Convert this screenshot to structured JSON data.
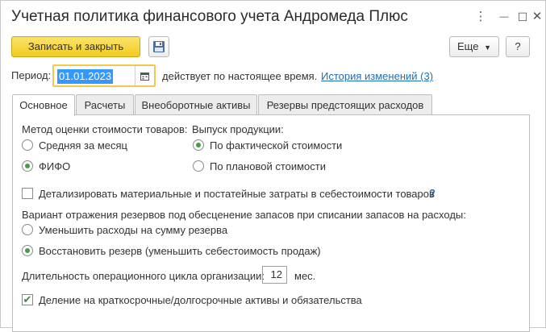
{
  "window": {
    "title": "Учетная политика финансового учета Андромеда Плюс",
    "controls": {
      "menu": "⋮",
      "minimize": "—",
      "maximize": "☐",
      "close": "✕"
    }
  },
  "toolbar": {
    "save_close_label": "Записать и закрыть",
    "more_label": "Еще",
    "help_label": "?"
  },
  "period": {
    "label": "Период:",
    "value": "01.01.2023",
    "note": "действует по настоящее время.",
    "history_link": "История изменений (3)"
  },
  "tabs": [
    {
      "label": "Основное",
      "active": true
    },
    {
      "label": "Расчеты",
      "active": false
    },
    {
      "label": "Внеоборотные активы",
      "active": false
    },
    {
      "label": "Резервы предстоящих расходов",
      "active": false
    }
  ],
  "main": {
    "cost_method": {
      "label": "Метод оценки стоимости товаров:",
      "options": [
        {
          "label": "Средняя за месяц",
          "selected": false
        },
        {
          "label": "ФИФО",
          "selected": true
        }
      ]
    },
    "production": {
      "label": "Выпуск продукции:",
      "options": [
        {
          "label": "По фактической стоимости",
          "selected": true
        },
        {
          "label": "По плановой стоимости",
          "selected": false
        }
      ]
    },
    "detail_costs": {
      "label": "Детализировать материальные и постатейные затраты в себестоимости товаров",
      "checked": false,
      "help": "?"
    },
    "reserves": {
      "label": "Вариант отражения резервов под обесценение запасов при списании запасов на расходы:",
      "options": [
        {
          "label": "Уменьшить расходы на сумму резерва",
          "selected": false
        },
        {
          "label": "Восстановить резерв (уменьшить себестоимость продаж)",
          "selected": true
        }
      ]
    },
    "cycle": {
      "label": "Длительность операционного цикла организации:",
      "value": "12",
      "unit": "мес."
    },
    "split_assets": {
      "label": "Деление на краткосрочные/долгосрочные активы и обязательства",
      "checked": true
    }
  },
  "colors": {
    "accent": "#f2cc1e",
    "link": "#1f6fb5",
    "selection": "#3399ff",
    "radio": "#4a9a4a"
  }
}
